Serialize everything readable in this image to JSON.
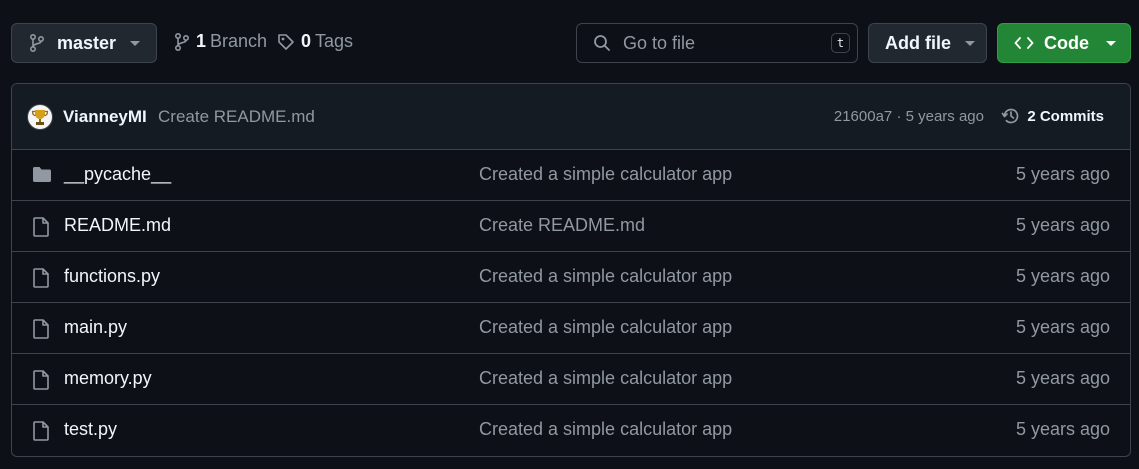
{
  "toolbar": {
    "branch_selector": {
      "label": "master"
    },
    "branches": {
      "count": "1",
      "label": "Branch"
    },
    "tags": {
      "count": "0",
      "label": "Tags"
    },
    "search": {
      "placeholder": "Go to file",
      "shortcut": "t"
    },
    "add_file": {
      "label": "Add file"
    },
    "code": {
      "label": "Code"
    }
  },
  "latest_commit": {
    "author": "VianneyMI",
    "message": "Create README.md",
    "sha_age": "21600a7 · 5 years ago",
    "commits_label": "2 Commits"
  },
  "files": [
    {
      "name": "__pycache__",
      "type": "folder",
      "message": "Created a simple calculator app",
      "age": "5 years ago"
    },
    {
      "name": "README.md",
      "type": "file",
      "message": "Create README.md",
      "age": "5 years ago"
    },
    {
      "name": "functions.py",
      "type": "file",
      "message": "Created a simple calculator app",
      "age": "5 years ago"
    },
    {
      "name": "main.py",
      "type": "file",
      "message": "Created a simple calculator app",
      "age": "5 years ago"
    },
    {
      "name": "memory.py",
      "type": "file",
      "message": "Created a simple calculator app",
      "age": "5 years ago"
    },
    {
      "name": "test.py",
      "type": "file",
      "message": "Created a simple calculator app",
      "age": "5 years ago"
    }
  ],
  "colors": {
    "background": "#0d1117",
    "border": "#3d444d",
    "primary_button": "#238636",
    "muted_text": "#9198a1"
  }
}
